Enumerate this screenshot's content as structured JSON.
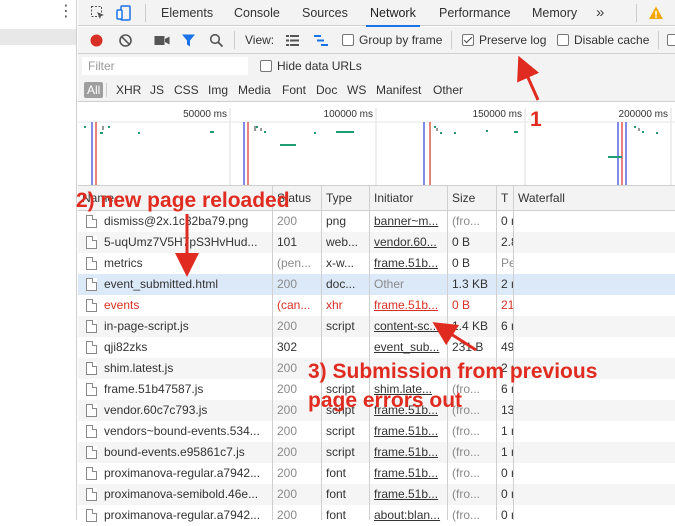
{
  "tabs": [
    {
      "label": "Elements"
    },
    {
      "label": "Console"
    },
    {
      "label": "Sources"
    },
    {
      "label": "Network"
    },
    {
      "label": "Performance"
    },
    {
      "label": "Memory"
    }
  ],
  "more_tabs": "»",
  "toolbar": {
    "view_label": "View:",
    "group_by_frame": "Group by frame",
    "preserve_log": "Preserve log",
    "disable_cache": "Disable cache"
  },
  "filter": {
    "placeholder": "Filter",
    "hide_data_urls": "Hide data URLs"
  },
  "type_filters": [
    "All",
    "XHR",
    "JS",
    "CSS",
    "Img",
    "Media",
    "Font",
    "Doc",
    "WS",
    "Manifest",
    "Other"
  ],
  "overview": {
    "ticks": [
      "50000 ms",
      "100000 ms",
      "150000 ms",
      "200000 ms"
    ]
  },
  "table": {
    "columns": [
      "Name",
      "Status",
      "Type",
      "Initiator",
      "Size",
      "T",
      "Waterfall"
    ],
    "rows": [
      {
        "name": "dismiss@2x.1c82ba79.png",
        "status": "200",
        "type": "png",
        "initiator": "banner~m...",
        "size": "(fro...",
        "time": "0 r"
      },
      {
        "name": "5-uqUmz7V5H7pS3HvHud...",
        "status": "101",
        "type": "web...",
        "initiator": "vendor.60...",
        "size": "0 B",
        "time": "2.8"
      },
      {
        "name": "metrics",
        "status": "(pen...",
        "type": "x-w...",
        "initiator": "frame.51b...",
        "size": "0 B",
        "time": "Pe"
      },
      {
        "name": "event_submitted.html",
        "status": "200",
        "type": "doc...",
        "initiator": "Other",
        "size": "1.3 KB",
        "time": "2 r"
      },
      {
        "name": "events",
        "status": "(can...",
        "type": "xhr",
        "initiator": "frame.51b...",
        "size": "0 B",
        "time": "21"
      },
      {
        "name": "in-page-script.js",
        "status": "200",
        "type": "script",
        "initiator": "content-sc...",
        "size": "1.4 KB",
        "time": "6 r"
      },
      {
        "name": "qji82zks",
        "status": "302",
        "type": "",
        "initiator": "event_sub...",
        "size": "231 B",
        "time": "49"
      },
      {
        "name": "shim.latest.js",
        "status": "200",
        "type": "",
        "initiator": "",
        "size": "",
        "time": "2 r"
      },
      {
        "name": "frame.51b47587.js",
        "status": "200",
        "type": "script",
        "initiator": "shim.late...",
        "size": "(fro...",
        "time": "6 r"
      },
      {
        "name": "vendor.60c7c793.js",
        "status": "200",
        "type": "script",
        "initiator": "frame.51b...",
        "size": "(fro...",
        "time": "13"
      },
      {
        "name": "vendors~bound-events.534...",
        "status": "200",
        "type": "script",
        "initiator": "frame.51b...",
        "size": "(fro...",
        "time": "1 r"
      },
      {
        "name": "bound-events.e95861c7.js",
        "status": "200",
        "type": "script",
        "initiator": "frame.51b...",
        "size": "(fro...",
        "time": "1 r"
      },
      {
        "name": "proximanova-regular.a7942...",
        "status": "200",
        "type": "font",
        "initiator": "frame.51b...",
        "size": "(fro...",
        "time": "0 r"
      },
      {
        "name": "proximanova-semibold.46e...",
        "status": "200",
        "type": "font",
        "initiator": "frame.51b...",
        "size": "(fro...",
        "time": "0 r"
      },
      {
        "name": "proximanova-regular.a7942...",
        "status": "200",
        "type": "font",
        "initiator": "about:blan...",
        "size": "(fro...",
        "time": "0 r"
      }
    ]
  },
  "annotations": {
    "one": "1",
    "two": "2) new page reloaded",
    "three_line1": "3) Submission from previous",
    "three_line2": "page errors out"
  },
  "colors": {
    "accent": "#1a73e8",
    "record": "#d93025",
    "error_text": "#d93025",
    "annotation": "#e02b20",
    "selected_row": "#dce9f8"
  }
}
